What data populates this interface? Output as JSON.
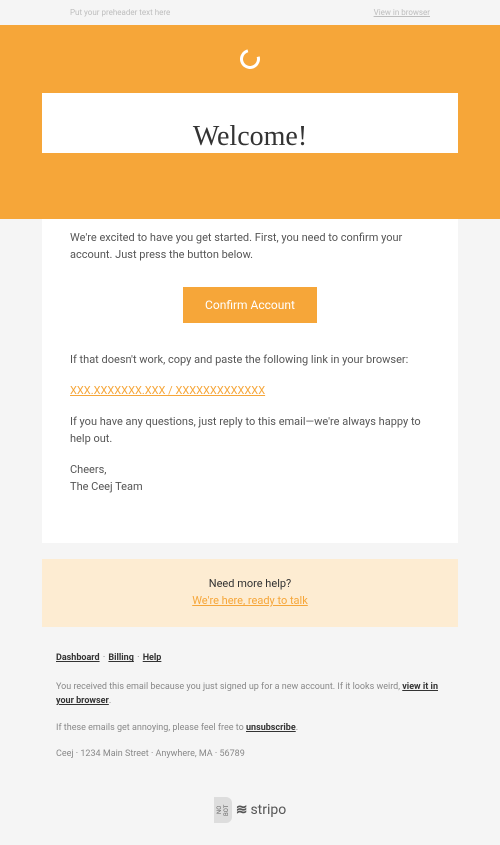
{
  "preheader": {
    "text": "Put your preheader text here",
    "view_link": "View in browser"
  },
  "card": {
    "title": "Welcome!",
    "intro": "We're excited to have you get started. First, you need to confirm your account. Just press the button below.",
    "button_label": "Confirm Account",
    "fallback_intro": "If that doesn't work, copy and paste the following link in your browser:",
    "fallback_link": "XXX.XXXXXXX.XXX / XXXXXXXXXXXXX",
    "questions": "If you have any questions, just reply to this email—we're always happy to help out.",
    "signoff": "Cheers,",
    "team": "The Ceej Team"
  },
  "help": {
    "title": "Need more help?",
    "link": "We're here, ready to talk"
  },
  "footer": {
    "links": {
      "dashboard": "Dashboard",
      "billing": "Billing",
      "help": "Help"
    },
    "sep": "·",
    "reason_pre": "You received this email because you just signed up for a new account. If it looks weird, ",
    "reason_link": "view it in your browser",
    "reason_post": ".",
    "unsub_pre": "If these emails get annoying, please feel free to ",
    "unsub_link": "unsubscribe",
    "unsub_post": ".",
    "address": "Ceej · 1234 Main Street · Anywhere, MA · 56789"
  },
  "stripo": {
    "badge": "NO BOT",
    "name": "stripo"
  }
}
